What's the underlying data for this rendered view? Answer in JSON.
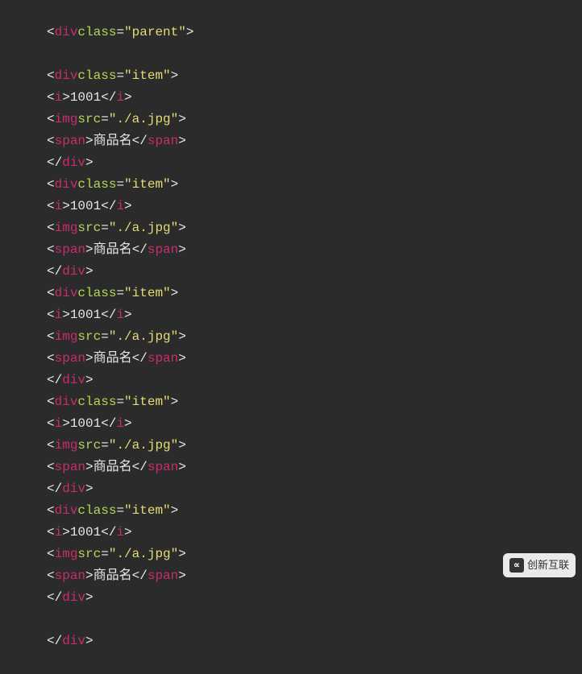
{
  "code": {
    "parent_tag": "div",
    "parent_class_attr": "class",
    "parent_class_value": "\"parent\"",
    "item_tag": "div",
    "item_class_attr": "class",
    "item_class_value": "\"item\"",
    "i_tag": "i",
    "i_content": "1001",
    "img_tag": "img",
    "img_src_attr": "src",
    "img_src_value": "\"./a.jpg\"",
    "span_tag": "span",
    "span_content": "商品名",
    "items": [
      {
        "id": 1
      },
      {
        "id": 2
      },
      {
        "id": 3
      },
      {
        "id": 4
      },
      {
        "id": 5
      }
    ]
  },
  "watermark": {
    "icon": "∝",
    "text": "创新互联"
  }
}
